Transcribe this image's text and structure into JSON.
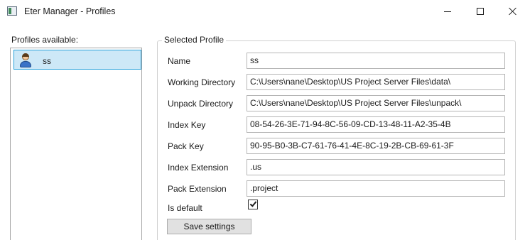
{
  "window": {
    "title": "Eter Manager - Profiles",
    "icon": "app-window-icon"
  },
  "profiles": {
    "label": "Profiles available:",
    "items": [
      {
        "name": "ss",
        "icon": "user-avatar-icon",
        "selected": true
      }
    ]
  },
  "selected_profile": {
    "legend": "Selected Profile",
    "fields": [
      {
        "label": "Name",
        "value": "ss"
      },
      {
        "label": "Working Directory",
        "value": "C:\\Users\\nane\\Desktop\\US Project Server Files\\data\\"
      },
      {
        "label": "Unpack Directory",
        "value": "C:\\Users\\nane\\Desktop\\US Project Server Files\\unpack\\"
      },
      {
        "label": "Index Key",
        "value": "08-54-26-3E-71-94-8C-56-09-CD-13-48-11-A2-35-4B"
      },
      {
        "label": "Pack Key",
        "value": "90-95-B0-3B-C7-61-76-41-4E-8C-19-2B-CB-69-61-3F"
      },
      {
        "label": "Index Extension",
        "value": ".us"
      },
      {
        "label": "Pack Extension",
        "value": ".project"
      }
    ],
    "is_default": {
      "label": "Is default",
      "checked": true
    },
    "save_label": "Save settings"
  },
  "colors": {
    "selection_bg": "#cde8f7",
    "selection_border": "#26a0da"
  }
}
